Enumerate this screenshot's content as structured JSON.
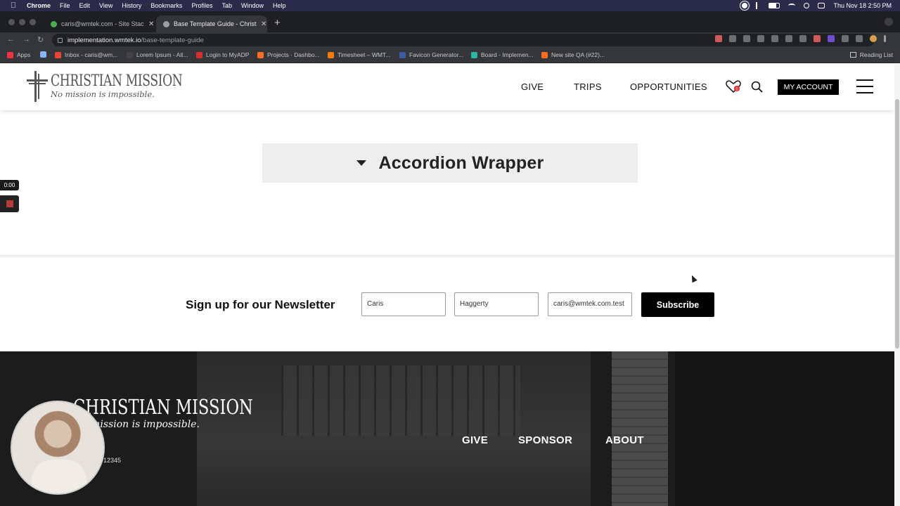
{
  "menubar": {
    "app": "Chrome",
    "items": [
      "File",
      "Edit",
      "View",
      "History",
      "Bookmarks",
      "Profiles",
      "Tab",
      "Window",
      "Help"
    ],
    "clock": "Thu Nov 18  2:50 PM"
  },
  "tabs": [
    {
      "title": "caris@wmtek.com - Site Stack",
      "favicon_color": "#4caf50"
    },
    {
      "title": "Base Template Guide - Christia",
      "favicon_color": "#9aa0a6"
    }
  ],
  "address_bar": {
    "host": "implementation.wmtek.io",
    "path": "/base-template-guide"
  },
  "bookmarks": {
    "items": [
      {
        "label": "Apps",
        "color": "#e34"
      },
      {
        "label": "",
        "color": "#8ab4f8"
      },
      {
        "label": "Inbox - caris@wm...",
        "color": "#ea4335"
      },
      {
        "label": "Lorem Ipsum - All...",
        "color": "#444"
      },
      {
        "label": "Login to MyADP",
        "color": "#d32f2f"
      },
      {
        "label": "Projects · Dashbo...",
        "color": "#fc6d26"
      },
      {
        "label": "Timesheet – WMT...",
        "color": "#f57c00"
      },
      {
        "label": "Favicon Generator...",
        "color": "#3b5ba5"
      },
      {
        "label": "Board - Implemen...",
        "color": "#2bb8a3"
      },
      {
        "label": "New site QA (#22)...",
        "color": "#fc6d26"
      }
    ],
    "reading_list": "Reading List"
  },
  "site": {
    "logo_title": "CHRISTIAN MISSION",
    "logo_tagline": "No mission is impossible.",
    "nav": [
      "GIVE",
      "TRIPS",
      "OPPORTUNITIES"
    ],
    "cart_count": "0",
    "account_label": "MY ACCOUNT"
  },
  "accordion": {
    "title": "Accordion Wrapper"
  },
  "newsletter": {
    "title": "Sign up for our Newsletter",
    "first_name": "Caris",
    "last_name": "Haggerty",
    "email": "caris@wmtek.com.test",
    "button": "Subscribe"
  },
  "footer": {
    "logo_title": "CHRISTIAN MISSION",
    "logo_tagline": "No mission is impossible.",
    "zip": "12345",
    "links": [
      "GIVE",
      "SPONSOR",
      "ABOUT"
    ]
  },
  "recorder": {
    "time": "0:00"
  }
}
